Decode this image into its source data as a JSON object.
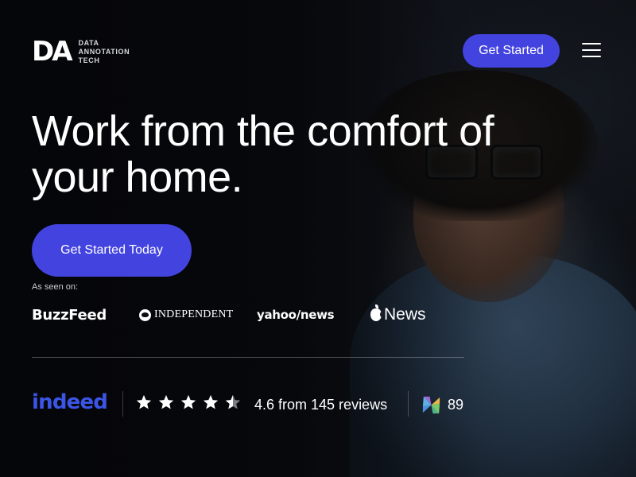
{
  "header": {
    "logo_mark": "DA",
    "logo_lines": [
      "DATA",
      "ANNOTATION",
      "TECH"
    ],
    "cta_label": "Get Started",
    "menu_icon": "hamburger-menu-icon"
  },
  "hero": {
    "headline": "Work from the comfort of your home.",
    "cta_label": "Get Started Today",
    "seen_on_label": "As seen on:"
  },
  "press": {
    "buzzfeed": "BuzzFeed",
    "independent": "INDEPENDENT",
    "yahoo": "yahoo/news",
    "apple_news": "News"
  },
  "ratings": {
    "indeed_logo": "indeed",
    "stars": 4.6,
    "reviews_text": "4.6 from 145 reviews",
    "g2_score": "89"
  },
  "colors": {
    "accent": "#4343e0",
    "indeed_blue": "#3b55e6",
    "text": "#ffffff"
  }
}
